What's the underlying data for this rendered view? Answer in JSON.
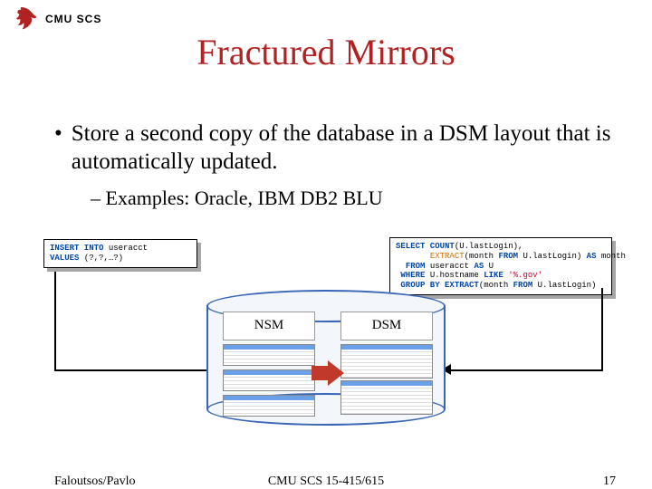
{
  "header": {
    "org": "CMU SCS"
  },
  "title": "Fractured Mirrors",
  "bullet": "Store a second copy of the database in a DSM layout that is automatically updated.",
  "sub_bullet": "Examples: Oracle, IBM DB2 BLU",
  "sql_left": {
    "kw1": "INSERT INTO",
    "tbl": "useracct",
    "kw2": "VALUES",
    "vals": "(?,?,…?)"
  },
  "sql_right": {
    "l1a": "SELECT COUNT",
    "l1b": "(U.lastLogin),",
    "l2a": "EXTRACT",
    "l2b": "(month ",
    "l2c": "FROM",
    "l2d": " U.lastLogin) ",
    "l2e": "AS",
    "l2f": " month",
    "l3a": "FROM",
    "l3b": " useracct ",
    "l3c": "AS",
    "l3d": " U",
    "l4a": "WHERE",
    "l4b": " U.hostname ",
    "l4c": "LIKE",
    "l4d": " '%.gov'",
    "l5a": "GROUP BY EXTRACT",
    "l5b": "(month ",
    "l5c": "FROM",
    "l5d": " U.lastLogin)"
  },
  "labels": {
    "nsm": "NSM",
    "dsm": "DSM"
  },
  "footer": {
    "left": "Faloutsos/Pavlo",
    "center": "CMU SCS 15-415/615",
    "right": "17"
  }
}
